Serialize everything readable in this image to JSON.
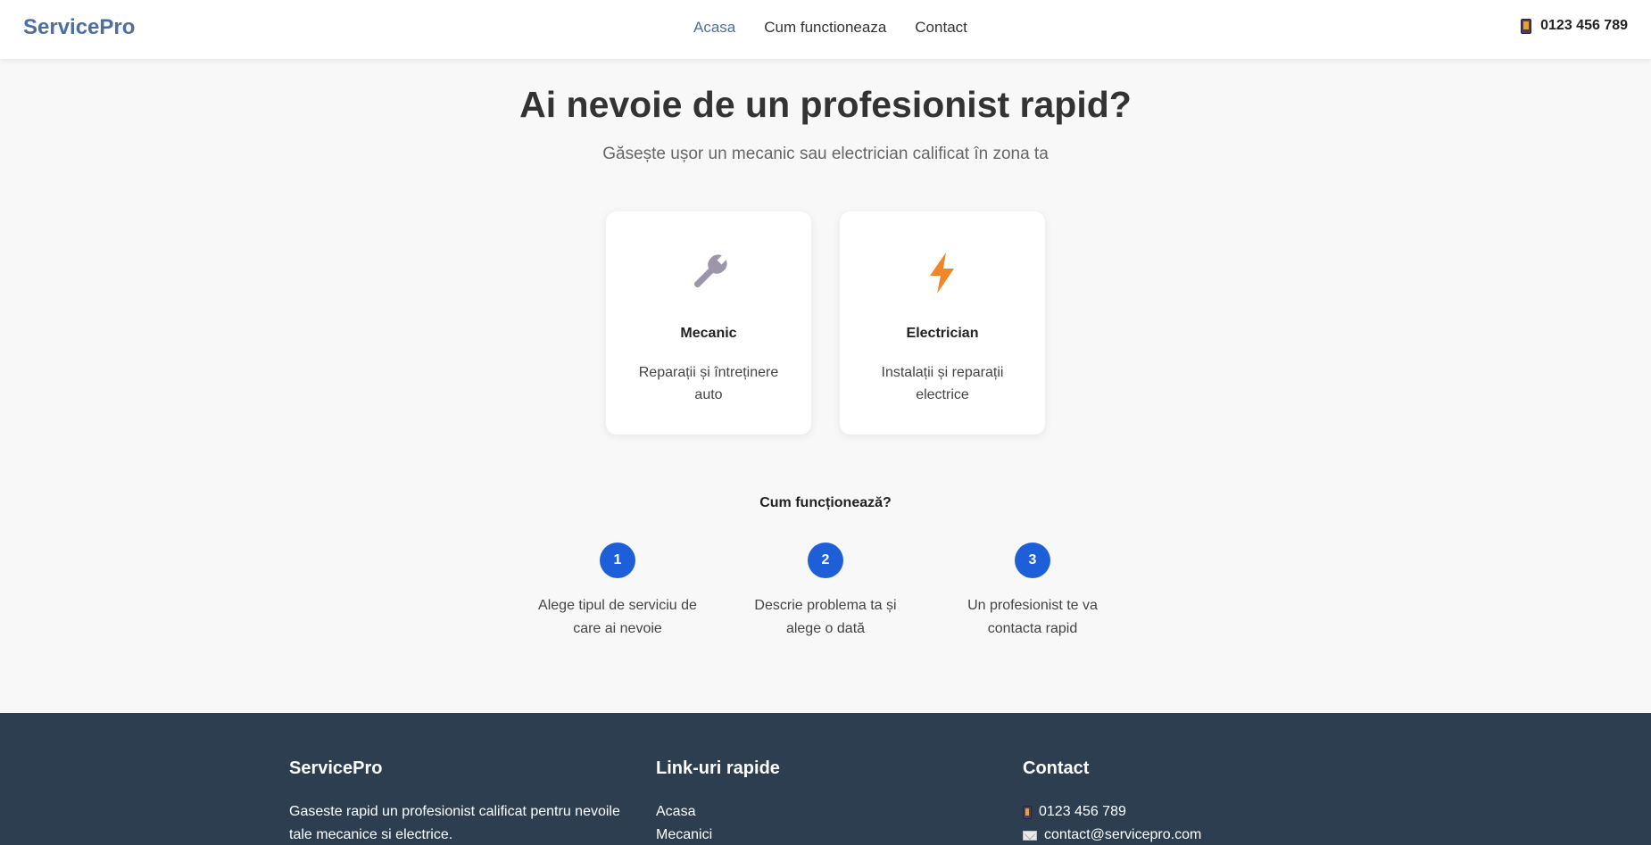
{
  "header": {
    "logo": "ServicePro",
    "nav": [
      {
        "label": "Acasa",
        "active": true
      },
      {
        "label": "Cum functioneaza",
        "active": false
      },
      {
        "label": "Contact",
        "active": false
      }
    ],
    "phone": "0123 456 789",
    "phone_icon": "phone-icon"
  },
  "hero": {
    "title": "Ai nevoie de un profesionist rapid?",
    "subtitle": "Găsește ușor un mecanic sau electrician calificat în zona ta"
  },
  "services": [
    {
      "icon": "wrench-icon",
      "title": "Mecanic",
      "description": "Reparații și întreținere auto",
      "icon_color": "#9c95ab"
    },
    {
      "icon": "lightning-icon",
      "title": "Electrician",
      "description": "Instalații și reparații electrice",
      "icon_color": "#f08628"
    }
  ],
  "how": {
    "title": "Cum funcționează?",
    "steps": [
      {
        "number": "1",
        "text": "Alege tipul de serviciu de care ai nevoie"
      },
      {
        "number": "2",
        "text": "Descrie problema ta și alege o dată"
      },
      {
        "number": "3",
        "text": "Un profesionist te va contacta rapid"
      }
    ]
  },
  "footer": {
    "col1": {
      "title": "ServicePro",
      "text": "Gaseste rapid un profesionist calificat pentru nevoile tale mecanice si electrice."
    },
    "col2": {
      "title": "Link-uri rapide",
      "links": [
        "Acasa",
        "Mecanici"
      ]
    },
    "col3": {
      "title": "Contact",
      "phone": "0123 456 789",
      "email": "contact@servicepro.com"
    }
  },
  "colors": {
    "brand": "#4a6fa5",
    "step_circle": "#1c5fd9",
    "footer_bg": "#2c3e50",
    "page_bg": "#f8f8f8"
  }
}
